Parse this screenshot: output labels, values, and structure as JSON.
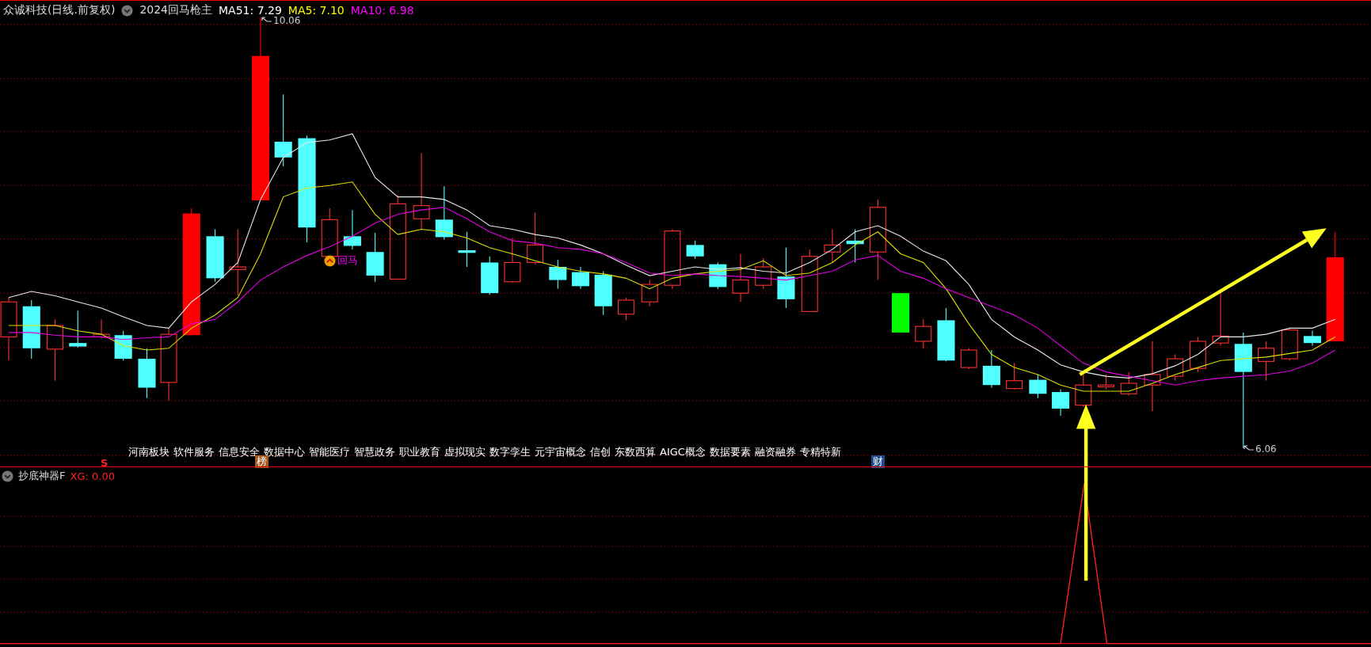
{
  "header": {
    "title": "众诚科技(日线.前复权)",
    "formula": "2024回马枪主",
    "indicators": [
      {
        "label": "MA51: 7.29",
        "color": "#ffffff"
      },
      {
        "label": "MA5: 7.10",
        "color": "#ffff00"
      },
      {
        "label": "MA10: 6.98",
        "color": "#ff00ff"
      }
    ]
  },
  "chart": {
    "high_label": "10.06",
    "low_label": "6.06",
    "signal_label": "回马",
    "concepts": [
      "河南板块",
      "软件服务",
      "信息安全",
      "数据中心",
      "智能医疗",
      "智慧政务",
      "职业教育",
      "虚拟现实",
      "数字孪生",
      "元宇宙概念",
      "信创",
      "东数西算",
      "AIGC概念",
      "数据要素",
      "融资融券",
      "专精特新"
    ],
    "markers": [
      {
        "text": "S",
        "kind": "plain",
        "color": "#ff2020"
      },
      {
        "text": "榜",
        "kind": "badge",
        "color": "#a0581c"
      },
      {
        "text": "财",
        "kind": "badge",
        "color": "#1d4c8c"
      }
    ]
  },
  "indicator_panel": {
    "title": "抄底神器F",
    "reading": "XG: 0.00"
  }
}
